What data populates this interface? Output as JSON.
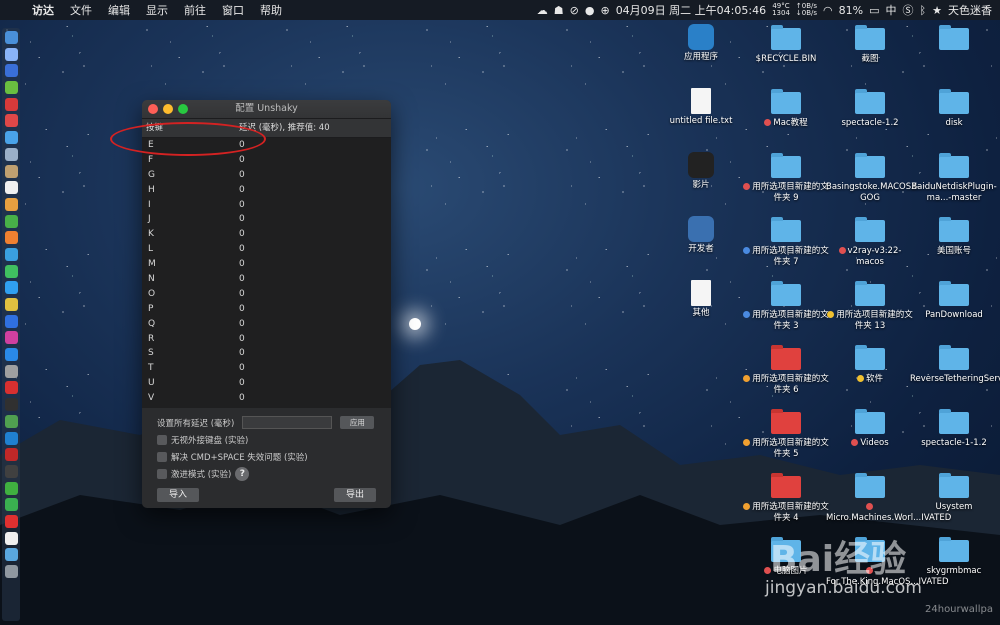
{
  "menubar": {
    "apple": "",
    "items": [
      "访达",
      "文件",
      "编辑",
      "显示",
      "前往",
      "窗口",
      "帮助"
    ],
    "temp": "49°C",
    "fan": "1304",
    "net_up": "0B/s",
    "net_down": "0B/s",
    "datetime": "04月09日 周二 上午04:05:46",
    "battery": "81%",
    "ime": "中",
    "user": "天色迷香"
  },
  "window": {
    "title": "配置 Unshaky",
    "col_key": "按键",
    "col_delay": "延迟 (毫秒), 推荐值: 40",
    "rows": [
      {
        "key": "E",
        "val": "0"
      },
      {
        "key": "F",
        "val": "0"
      },
      {
        "key": "G",
        "val": "0"
      },
      {
        "key": "H",
        "val": "0"
      },
      {
        "key": "I",
        "val": "0"
      },
      {
        "key": "J",
        "val": "0"
      },
      {
        "key": "K",
        "val": "0"
      },
      {
        "key": "L",
        "val": "0"
      },
      {
        "key": "M",
        "val": "0"
      },
      {
        "key": "N",
        "val": "0"
      },
      {
        "key": "O",
        "val": "0"
      },
      {
        "key": "P",
        "val": "0"
      },
      {
        "key": "Q",
        "val": "0"
      },
      {
        "key": "R",
        "val": "0"
      },
      {
        "key": "S",
        "val": "0"
      },
      {
        "key": "T",
        "val": "0"
      },
      {
        "key": "U",
        "val": "0"
      },
      {
        "key": "V",
        "val": "0"
      }
    ],
    "set_all_label": "设置所有延迟 (毫秒)",
    "apply": "应用",
    "opt1": "无视外接键盘 (实验)",
    "opt2": "解决 CMD+SPACE 失效问题 (实验)",
    "opt3": "激进模式 (实验)",
    "help": "?",
    "import": "导入",
    "export": "导出"
  },
  "desktop": {
    "col1": [
      "应用程序",
      "untitled file.txt",
      "影片",
      "开发者",
      "其他"
    ],
    "col2": [
      "$RECYCLE.BIN",
      "Mac教程",
      "用所选项目新建的文件夹 9",
      "用所选项目新建的文件夹 7",
      "用所选项目新建的文件夹 3",
      "用所选项目新建的文件夹 6",
      "用所选项目新建的文件夹 5",
      "用所选项目新建的文件夹 4",
      "电脑图片"
    ],
    "col3": [
      "截图",
      "spectacle-1.2",
      "Basingstoke.MACOSX-GOG",
      "v2ray-v3.22-macos",
      "用所选项目新建的文件夹 13",
      "软件",
      "Videos",
      "Micro.Machines.Worl...IVATED",
      "For.The.King.MacOS...IVATED"
    ],
    "col4": [
      "",
      "disk",
      "BaiduNetdiskPlugin-ma...-master",
      "美国账号",
      "PanDownload",
      "ReverseTetheringServer_1.2.0",
      "spectacle-1-1.2",
      "Usystem",
      "skygrmbmac"
    ]
  },
  "watermark": {
    "brand": "Bai经验",
    "url": "jingyan.baidu.com",
    "corner": "24hourwallpa"
  },
  "colors": {
    "folder": "#5fb4e8",
    "folder_red": "#e0413e",
    "annotation": "#d42222"
  }
}
